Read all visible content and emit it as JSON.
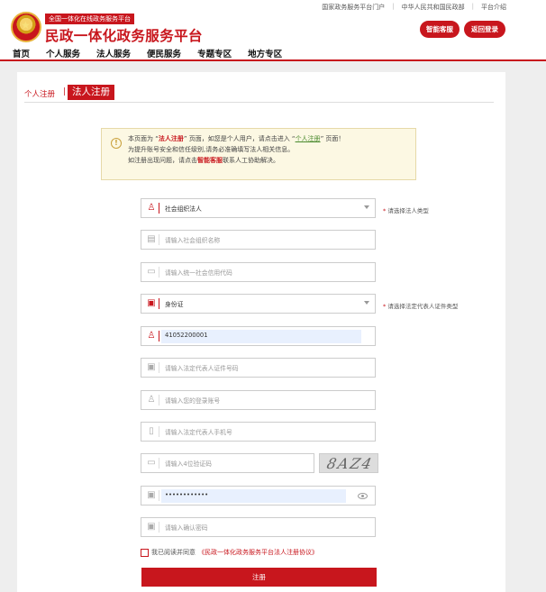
{
  "header": {
    "subtitle": "全国一体化在线政务服务平台",
    "title": "民政一体化政务服务平台",
    "links": [
      "国家政务服务平台门户",
      "中华人民共和国民政部",
      "平台介绍"
    ],
    "btn_service": "智能客服",
    "btn_back": "返回登录",
    "brand_color": "#c8161d"
  },
  "nav": [
    "首页",
    "个人服务",
    "法人服务",
    "便民服务",
    "专题专区",
    "地方专区"
  ],
  "tabs": {
    "personal": "个人注册",
    "separator": "|",
    "corporate": "法人注册"
  },
  "notice": {
    "l1_a": "本页面为 “",
    "l1_b": "法人注册",
    "l1_c": "” 页面，如您是个人用户，请点击进入 “",
    "l1_link": "个人注册",
    "l1_d": "” 页面！",
    "line2": "为提升账号安全和信任级别,请务必准确填写法人相关信息。",
    "l3_a": "如注册出现问题，请点击",
    "l3_b": "智能客服",
    "l3_c": "联系人工协助解决。"
  },
  "form": {
    "org_type": "社会组织法人",
    "org_type_hint": "请选择法人类型",
    "org_name": "请输入社会组织名称",
    "credit_code": "请输入统一社会信用代码",
    "id_type": "身份证",
    "id_type_hint": "请选择法定代表人证件类型",
    "username": "41052200001",
    "rep_id": "请输入法定代表人证件号码",
    "login_account": "请输入您的登录账号",
    "rep_phone": "请输入法定代表人手机号",
    "verify_code": "请输入4位验证码",
    "captcha": "8AZ4",
    "password": "••••••••••••",
    "confirm_password": "请输入确认密码",
    "required_star": "*",
    "agree_text": "我已阅读并同意",
    "agree_link": "《民政一体化政务服务平台法人注册协议》",
    "submit": "注册"
  }
}
